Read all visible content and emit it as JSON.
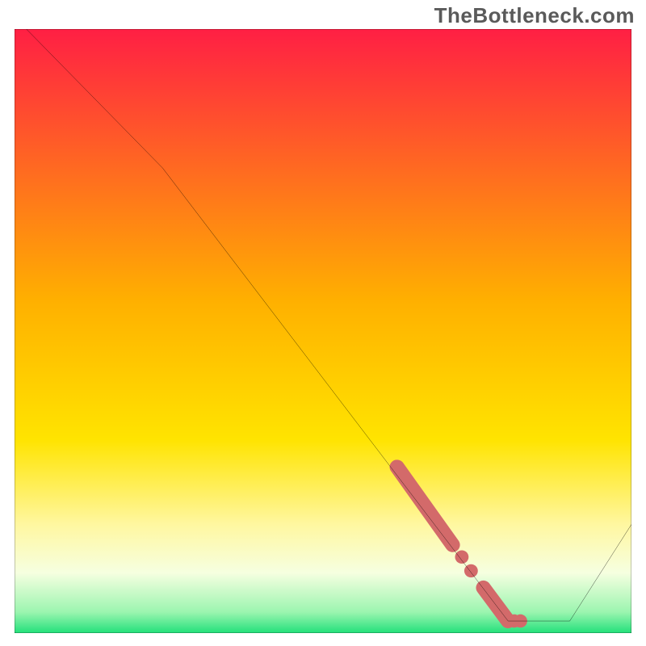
{
  "watermark": "TheBottleneck.com",
  "chart_data": {
    "type": "line",
    "title": "",
    "xlabel": "",
    "ylabel": "",
    "xlim": [
      0,
      100
    ],
    "ylim": [
      0,
      100
    ],
    "background_gradient": {
      "stops": [
        {
          "pct": 0.0,
          "color": "#ff1f44"
        },
        {
          "pct": 0.45,
          "color": "#ffb000"
        },
        {
          "pct": 0.68,
          "color": "#ffe400"
        },
        {
          "pct": 0.82,
          "color": "#fff7a0"
        },
        {
          "pct": 0.9,
          "color": "#f6ffe0"
        },
        {
          "pct": 0.965,
          "color": "#9cf5b0"
        },
        {
          "pct": 1.0,
          "color": "#22e07a"
        }
      ]
    },
    "series": [
      {
        "name": "curve",
        "color": "#000000",
        "points": [
          {
            "x": 0,
            "y": 102
          },
          {
            "x": 24,
            "y": 77
          },
          {
            "x": 80,
            "y": 2
          },
          {
            "x": 90,
            "y": 2
          },
          {
            "x": 100,
            "y": 18
          }
        ]
      }
    ],
    "highlight": {
      "color": "#d36a6a",
      "thick_segments": [
        {
          "x1": 62,
          "y1": 27.5,
          "x2": 71,
          "y2": 14.6
        },
        {
          "x1": 76,
          "y1": 7.5,
          "x2": 80,
          "y2": 2.0
        }
      ],
      "dots": [
        {
          "x": 72.5,
          "y": 12.6
        },
        {
          "x": 74.0,
          "y": 10.3
        },
        {
          "x": 81.0,
          "y": 2.0
        },
        {
          "x": 82.0,
          "y": 2.0
        }
      ]
    }
  }
}
